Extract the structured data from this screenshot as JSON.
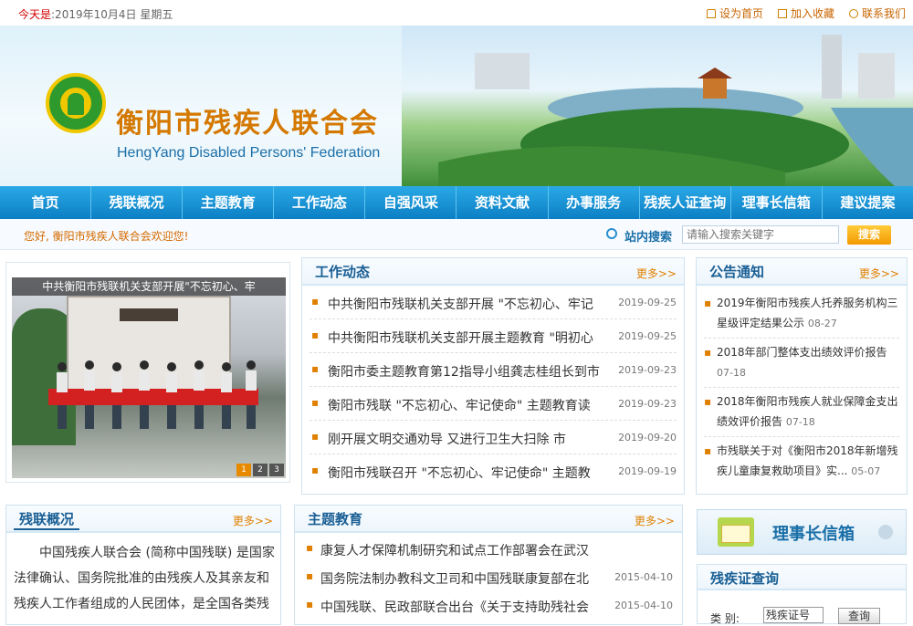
{
  "topbar": {
    "date_label": "今天是",
    "date_text": ":2019年10月4日  星期五",
    "links": [
      {
        "label": "设为首页",
        "icon": "home-icon"
      },
      {
        "label": "加入收藏",
        "icon": "bookmark-icon"
      },
      {
        "label": "联系我们",
        "icon": "contact-icon"
      }
    ]
  },
  "banner": {
    "title_cn": "衡阳市残疾人联合会",
    "title_en": "HengYang Disabled Persons' Federation"
  },
  "nav": [
    "首页",
    "残联概况",
    "主题教育",
    "工作动态",
    "自强风采",
    "资料文献",
    "办事服务",
    "残疾人证查询",
    "理事长信箱",
    "建议提案"
  ],
  "searchbar": {
    "welcome": "您好, 衡阳市残疾人联合会欢迎您!",
    "label": "站内搜索",
    "placeholder": "请输入搜索关键字",
    "button": "搜索"
  },
  "slide": {
    "caption": "中共衡阳市残联机关支部开展\"不忘初心、牢",
    "pages": [
      "1",
      "2",
      "3"
    ]
  },
  "work_news": {
    "title": "工作动态",
    "more": "更多>>",
    "items": [
      {
        "title": "中共衡阳市残联机关支部开展 \"不忘初心、牢记",
        "date": "2019-09-25"
      },
      {
        "title": "中共衡阳市残联机关支部开展主题教育 \"明初心",
        "date": "2019-09-25"
      },
      {
        "title": "衡阳市委主题教育第12指导小组龚志桂组长到市",
        "date": "2019-09-23"
      },
      {
        "title": "衡阳市残联 \"不忘初心、牢记使命\" 主题教育读",
        "date": "2019-09-23"
      },
      {
        "title": "刚开展文明交通劝导 又进行卫生大扫除  市",
        "date": "2019-09-20"
      },
      {
        "title": "衡阳市残联召开 \"不忘初心、牢记使命\" 主题教",
        "date": "2019-09-19"
      }
    ]
  },
  "notice": {
    "title": "公告通知",
    "more": "更多>>",
    "items": [
      {
        "line1": "2019年衡阳市残疾人托养服务机构三",
        "line2": "星级评定结果公示",
        "date": "08-27"
      },
      {
        "line1": "2018年部门整体支出绩效评价报告",
        "line2": "",
        "date": "07-18"
      },
      {
        "line1": "2018年衡阳市残疾人就业保障金支出",
        "line2": "绩效评价报告",
        "date": "07-18"
      },
      {
        "line1": "市残联关于对《衡阳市2018年新增残",
        "line2": "疾儿童康复救助项目》实...",
        "date": "05-07"
      }
    ]
  },
  "overview": {
    "title": "残联概况",
    "more": "更多>>",
    "lines": [
      "中国残疾人联合会 (简称中国残联) 是国家",
      "法律确认、国务院批准的由残疾人及其亲友和",
      "残疾人工作者组成的人民团体，是全国各类残"
    ]
  },
  "theme_edu": {
    "title": "主题教育",
    "more": "更多>>",
    "items": [
      {
        "title": "康复人才保障机制研究和试点工作部署会在武汉",
        "date": ""
      },
      {
        "title": "国务院法制办教科文卫司和中国残联康复部在北",
        "date": "2015-04-10"
      },
      {
        "title": "中国残联、民政部联合出台《关于支持助残社会",
        "date": "2015-04-10"
      }
    ]
  },
  "mailbox": {
    "label": "理事长信箱"
  },
  "cert_query": {
    "title": "残疾证查询",
    "type_label": "类  别:",
    "type_value": "残疾证号",
    "button": "查询"
  }
}
